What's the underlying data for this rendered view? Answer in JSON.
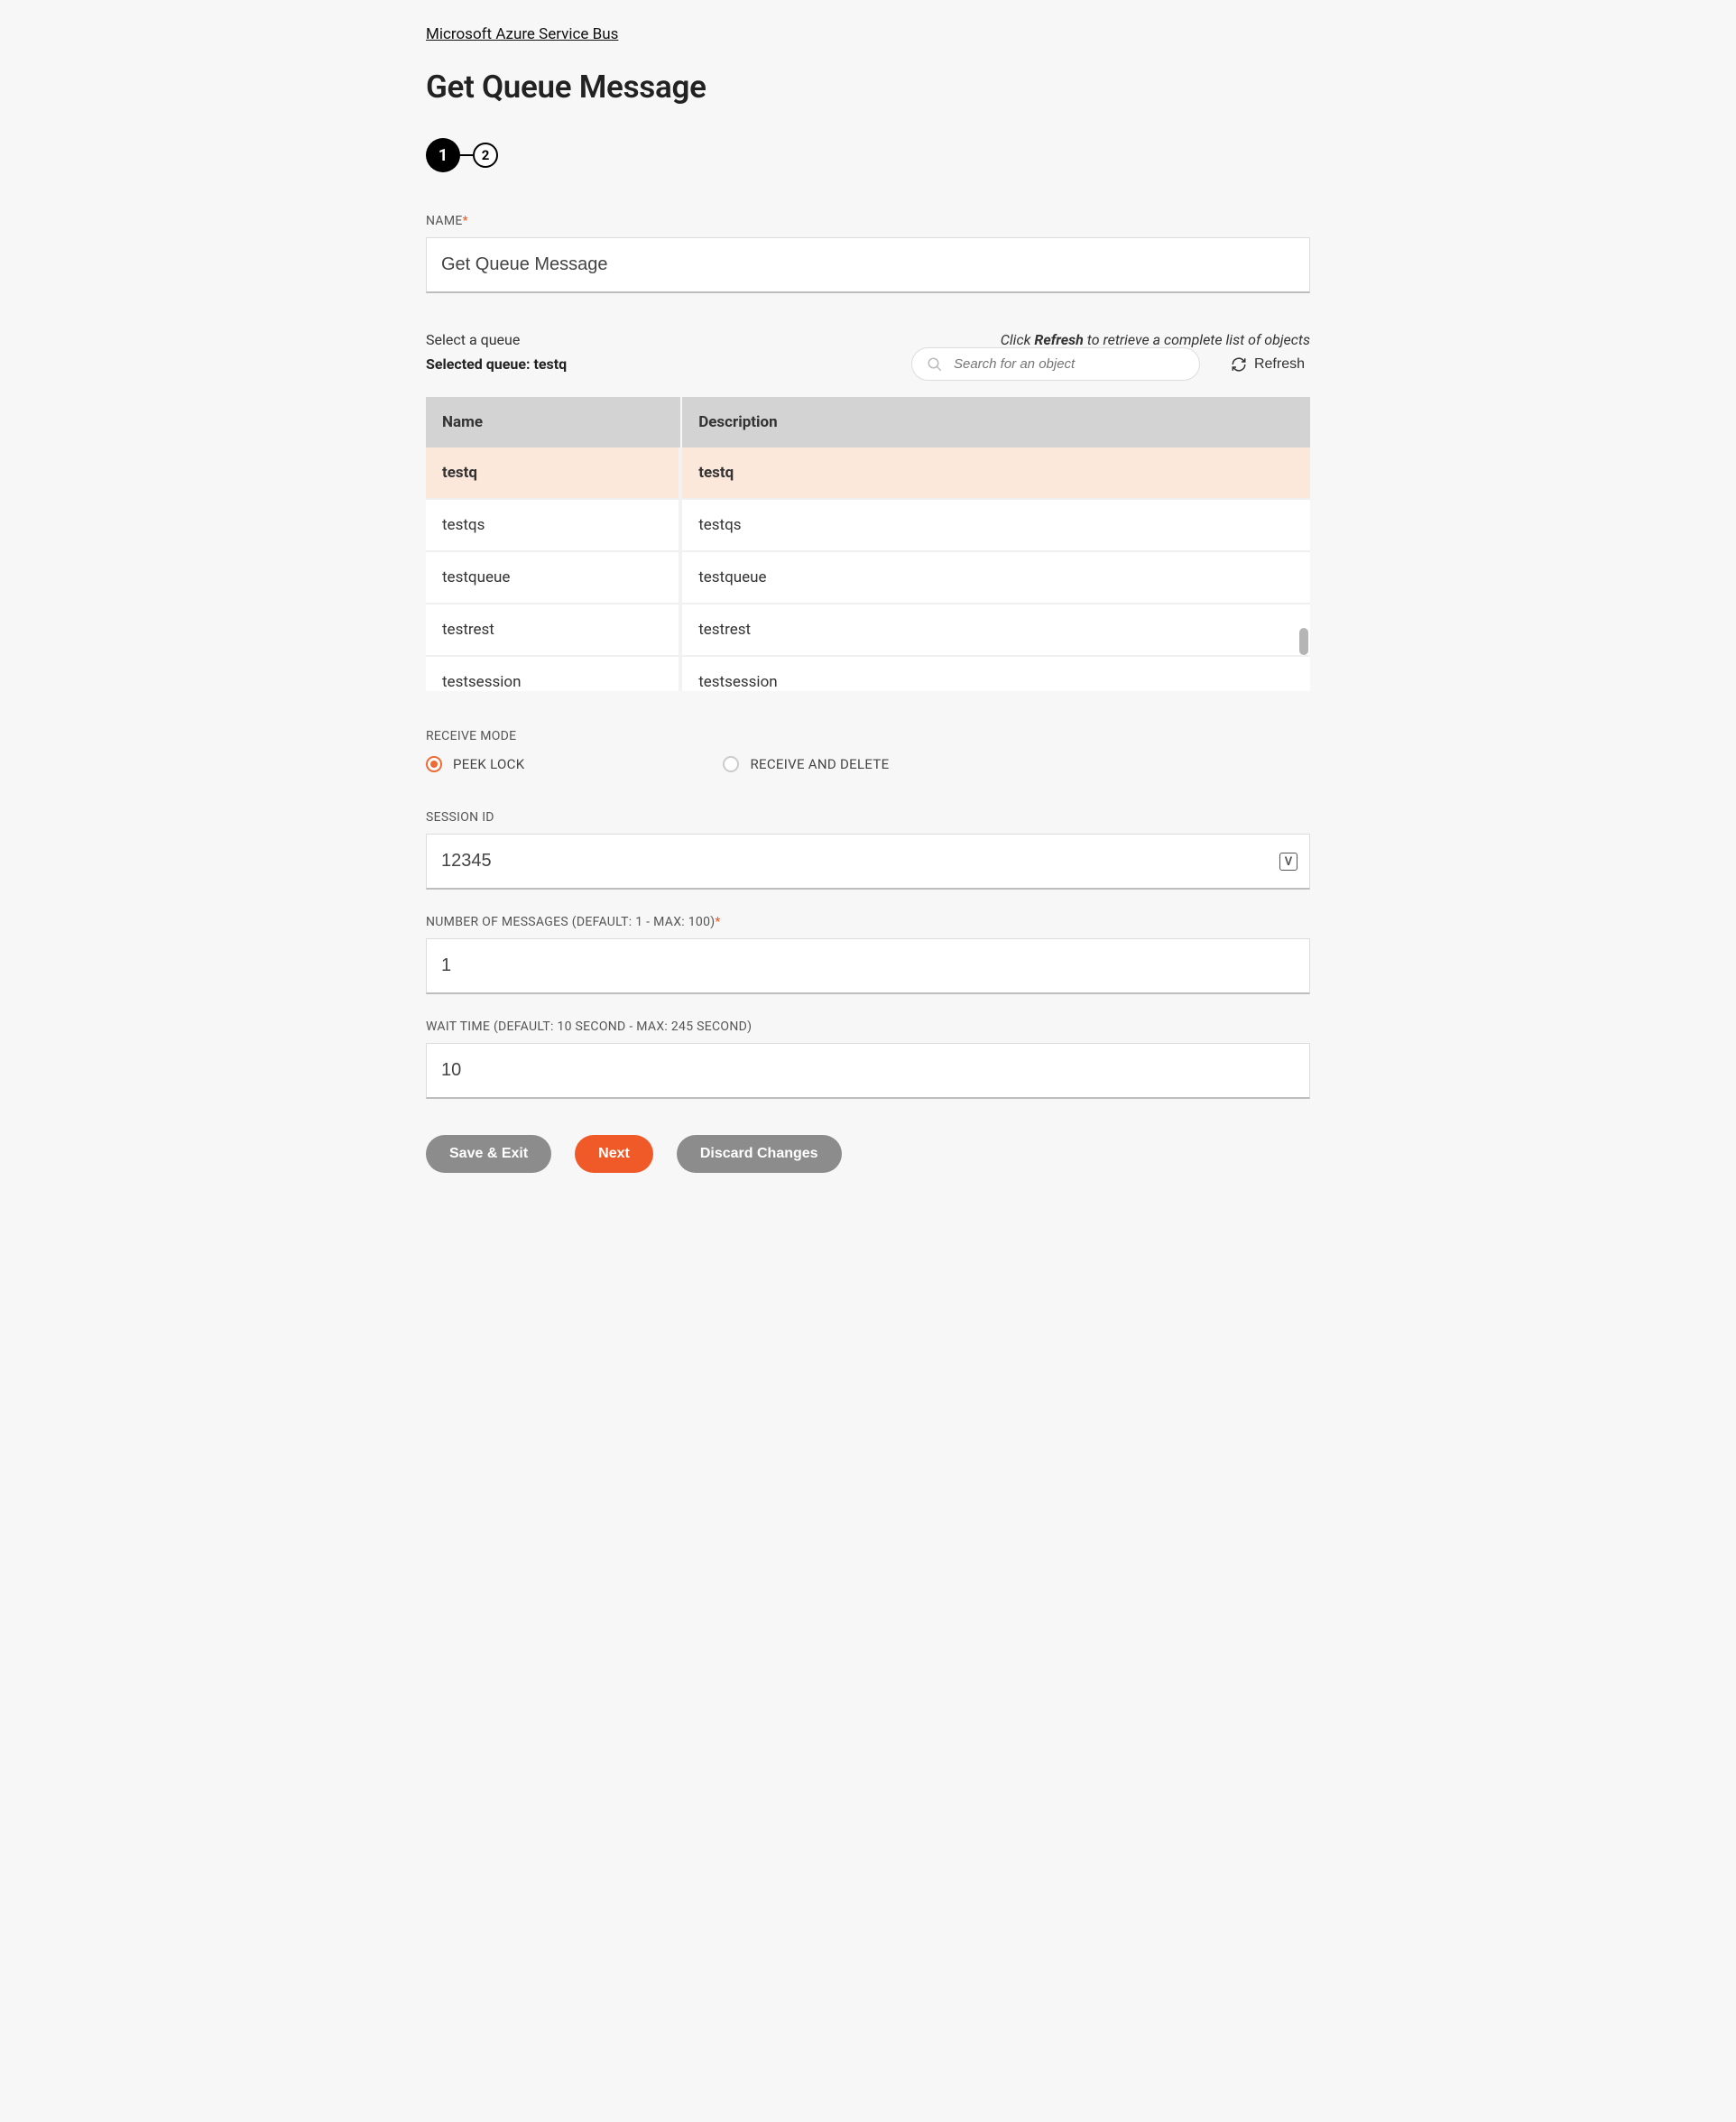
{
  "breadcrumb": {
    "label": "Microsoft Azure Service Bus"
  },
  "page_title": "Get Queue Message",
  "stepper": {
    "steps": [
      "1",
      "2"
    ],
    "active_index": 0
  },
  "fields": {
    "name": {
      "label": "NAME",
      "required": true,
      "value": "Get Queue Message"
    },
    "session_id": {
      "label": "SESSION ID",
      "value": "12345"
    },
    "num_messages": {
      "label": "NUMBER OF MESSAGES (DEFAULT: 1 - MAX: 100)",
      "required": true,
      "value": "1"
    },
    "wait_time": {
      "label": "WAIT TIME (DEFAULT: 10 SECOND - MAX: 245 SECOND)",
      "value": "10"
    }
  },
  "queue_section": {
    "select_label": "Select a queue",
    "hint_prefix": "Click ",
    "hint_bold": "Refresh",
    "hint_suffix": " to retrieve a complete list of objects",
    "selected_label": "Selected queue: ",
    "selected_value": "testq",
    "search_placeholder": "Search for an object",
    "refresh_label": "Refresh",
    "columns": {
      "name": "Name",
      "description": "Description"
    },
    "rows": [
      {
        "name": "testq",
        "description": "testq",
        "selected": true
      },
      {
        "name": "testqs",
        "description": "testqs",
        "selected": false
      },
      {
        "name": "testqueue",
        "description": "testqueue",
        "selected": false
      },
      {
        "name": "testrest",
        "description": "testrest",
        "selected": false
      },
      {
        "name": "testsession",
        "description": "testsession",
        "selected": false
      }
    ]
  },
  "receive_mode": {
    "label": "RECEIVE MODE",
    "options": [
      {
        "label": "PEEK LOCK",
        "checked": true
      },
      {
        "label": "RECEIVE AND DELETE",
        "checked": false
      }
    ]
  },
  "buttons": {
    "save_exit": "Save & Exit",
    "next": "Next",
    "discard": "Discard Changes"
  }
}
